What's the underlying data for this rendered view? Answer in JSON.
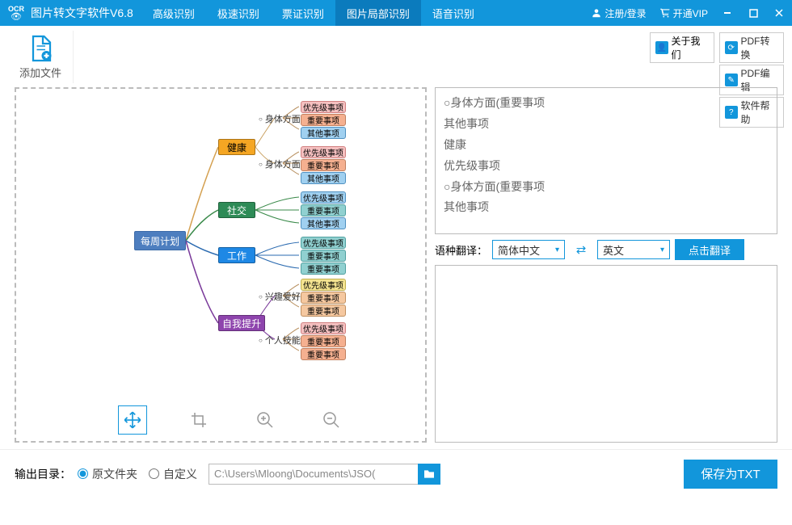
{
  "app_title": "图片转文字软件V6.8",
  "menu": [
    "高级识别",
    "极速识别",
    "票证识别",
    "图片局部识别",
    "语音识别"
  ],
  "active_menu": 3,
  "user": {
    "register": "注册/登录",
    "vip": "开通VIP"
  },
  "add_file": "添加文件",
  "links": {
    "about": "关于我们",
    "pdf_convert": "PDF转换",
    "pdf_edit": "PDF编辑",
    "help": "软件帮助"
  },
  "mindmap": {
    "root": "每周计划",
    "cats": [
      {
        "label": "健康",
        "cls": "orange",
        "subs": [
          "身体方面",
          "身体方面"
        ]
      },
      {
        "label": "社交",
        "cls": "green"
      },
      {
        "label": "工作",
        "cls": "blue"
      },
      {
        "label": "自我提升",
        "cls": "purple",
        "subs": [
          "兴趣爱好",
          "个人技能"
        ]
      }
    ],
    "tags": {
      "p": "优先级事项",
      "i": "重要事项",
      "o": "其他事项"
    }
  },
  "result_lines": [
    "○身体方面(重要事项",
    "其他事项",
    "健康",
    "优先级事项",
    "○身体方面(重要事项",
    "其他事项"
  ],
  "translate": {
    "label": "语种翻译：",
    "from": "简体中文",
    "to": "英文",
    "btn": "点击翻译"
  },
  "output": {
    "label": "输出目录：",
    "opt1": "原文件夹",
    "opt2": "自定义",
    "path": "C:\\Users\\Mloong\\Documents\\JSO("
  },
  "save": "保存为TXT"
}
